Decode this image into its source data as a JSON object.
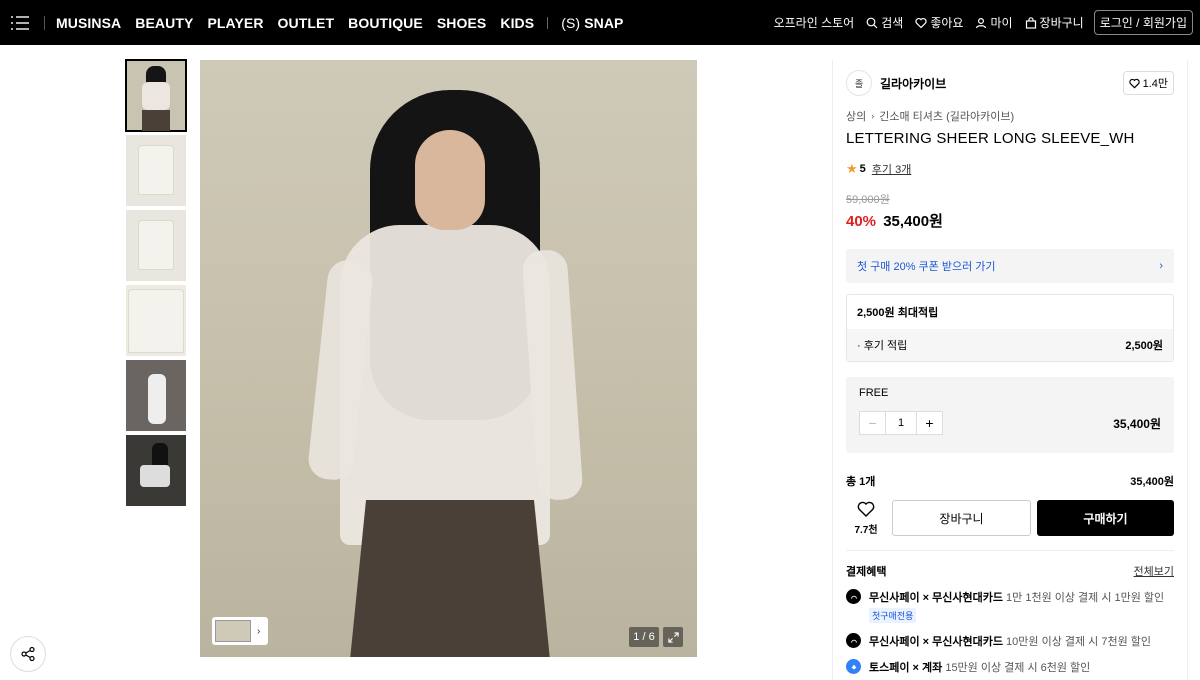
{
  "nav": {
    "items": [
      "MUSINSA",
      "BEAUTY",
      "PLAYER",
      "OUTLET",
      "BOUTIQUE",
      "SHOES",
      "KIDS"
    ],
    "snap_prefix": "(S)",
    "snap_label": "SNAP",
    "right": {
      "offline": "오프라인 스토어",
      "search": "검색",
      "likes": "좋아요",
      "my": "마이",
      "cart": "장바구니",
      "login": "로그인 / 회원가입"
    }
  },
  "gallery": {
    "counter": "1 / 6",
    "thumb_count": 6
  },
  "product": {
    "brand_logo": "졸",
    "brand_name": "길라아카이브",
    "brand_likes": "1.4만",
    "breadcrumb": [
      "상의",
      "긴소매 티셔츠 (길라아카이브)"
    ],
    "title": "LETTERING SHEER LONG SLEEVE_WH",
    "rating": "5",
    "review_link": "후기 3개",
    "original_price": "59,000원",
    "discount": "40%",
    "price": "35,400원",
    "coupon_banner": "첫 구매 20% 쿠폰 받으러 가기",
    "points_title": "2,500원 최대적립",
    "points_row_label": "· 후기 적립",
    "points_row_value": "2,500원",
    "option_label": "FREE",
    "quantity": "1",
    "option_price": "35,400원",
    "total_label": "총 1개",
    "total_value": "35,400원",
    "wish_count": "7.7천",
    "cart_button": "장바구니",
    "buy_button": "구매하기"
  },
  "benefits": {
    "title": "결제혜택",
    "see_all": "전체보기",
    "items": [
      {
        "bold": "무신사페이 × 무신사현대카드",
        "text": " 1만 1천원 이상 결제 시 1만원 할인",
        "tag": "첫구매전용"
      },
      {
        "bold": "무신사페이 × 무신사현대카드",
        "text": " 10만원 이상 결제 시 7천원 할인",
        "tag": ""
      },
      {
        "bold": "토스페이 × 계좌",
        "text": " 15만원 이상 결제 시 6천원 할인",
        "tag": ""
      }
    ]
  }
}
